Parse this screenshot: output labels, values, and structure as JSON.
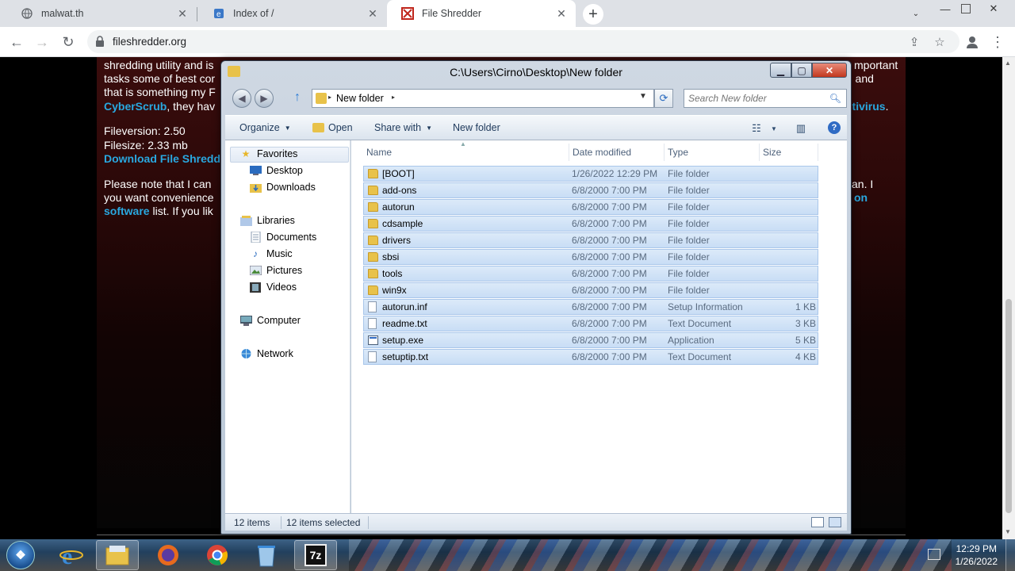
{
  "browser": {
    "tabs": [
      {
        "title": "malwat.th",
        "icon": "globe-icon"
      },
      {
        "title": "Index of /",
        "icon": "ie-page-icon"
      },
      {
        "title": "File Shredder",
        "icon": "shredder-favicon-icon"
      }
    ],
    "url": "fileshredder.org"
  },
  "webpage": {
    "lines": [
      "shredding utility and is",
      "tasks some of best cor",
      "that is something my F",
      "CyberScrub",
      ", they hav",
      "Fileversion: 2.50",
      "Filesize: 2.33 mb",
      "Download File Shredd",
      "Please note that I can",
      "you want convenience",
      "software",
      " list. If you lik"
    ],
    "right_fragments": [
      "mportant",
      ") and",
      "ntivirus",
      ".",
      "an. I",
      "on"
    ]
  },
  "explorer": {
    "title": "C:\\Users\\Cirno\\Desktop\\New folder",
    "breadcrumb": "New folder",
    "search_placeholder": "Search New folder",
    "commands": {
      "organize": "Organize",
      "open": "Open",
      "share_with": "Share with",
      "new_folder": "New folder"
    },
    "nav": {
      "favorites": "Favorites",
      "favorites_items": [
        "Desktop",
        "Downloads"
      ],
      "libraries": "Libraries",
      "libraries_items": [
        "Documents",
        "Music",
        "Pictures",
        "Videos"
      ],
      "computer": "Computer",
      "network": "Network"
    },
    "columns": [
      "Name",
      "Date modified",
      "Type",
      "Size"
    ],
    "files": [
      {
        "name": "[BOOT]",
        "date": "1/26/2022 12:29 PM",
        "type": "File folder",
        "size": "",
        "kind": "folder"
      },
      {
        "name": "add-ons",
        "date": "6/8/2000 7:00 PM",
        "type": "File folder",
        "size": "",
        "kind": "folder"
      },
      {
        "name": "autorun",
        "date": "6/8/2000 7:00 PM",
        "type": "File folder",
        "size": "",
        "kind": "folder"
      },
      {
        "name": "cdsample",
        "date": "6/8/2000 7:00 PM",
        "type": "File folder",
        "size": "",
        "kind": "folder"
      },
      {
        "name": "drivers",
        "date": "6/8/2000 7:00 PM",
        "type": "File folder",
        "size": "",
        "kind": "folder"
      },
      {
        "name": "sbsi",
        "date": "6/8/2000 7:00 PM",
        "type": "File folder",
        "size": "",
        "kind": "folder"
      },
      {
        "name": "tools",
        "date": "6/8/2000 7:00 PM",
        "type": "File folder",
        "size": "",
        "kind": "folder"
      },
      {
        "name": "win9x",
        "date": "6/8/2000 7:00 PM",
        "type": "File folder",
        "size": "",
        "kind": "folder"
      },
      {
        "name": "autorun.inf",
        "date": "6/8/2000 7:00 PM",
        "type": "Setup Information",
        "size": "1 KB",
        "kind": "doc"
      },
      {
        "name": "readme.txt",
        "date": "6/8/2000 7:00 PM",
        "type": "Text Document",
        "size": "3 KB",
        "kind": "doc"
      },
      {
        "name": "setup.exe",
        "date": "6/8/2000 7:00 PM",
        "type": "Application",
        "size": "5 KB",
        "kind": "app"
      },
      {
        "name": "setuptip.txt",
        "date": "6/8/2000 7:00 PM",
        "type": "Text Document",
        "size": "4 KB",
        "kind": "doc"
      }
    ],
    "status": {
      "count": "12 items",
      "selected": "12 items selected"
    }
  },
  "taskbar": {
    "time": "12:29 PM",
    "date": "1/26/2022",
    "seven_zip_label": "7z"
  }
}
